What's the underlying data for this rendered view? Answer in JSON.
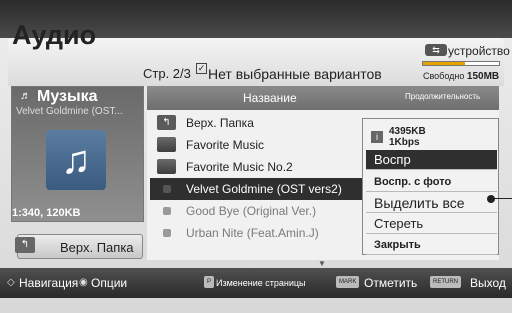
{
  "header": {
    "title": "Аудио",
    "page_indicator": "Стр. 2/3",
    "selection_status": "Нет выбранные вариантов",
    "device_label": "устройство",
    "device_icon": "usb-icon",
    "storage_used_fraction": 0.55,
    "free_label": "Свободно",
    "free_value": "150MB"
  },
  "folder_panel": {
    "heading": "Музыка",
    "subtitle": "Velvet Goldmine (OST...",
    "info": "1:340, 120KB",
    "art_icon": "music-note-icon",
    "up_button_label": "Верх. Папка"
  },
  "list": {
    "col_name": "Название",
    "col_duration": "Продолжительность",
    "rows": [
      {
        "label": "Верх. Папка",
        "type": "up"
      },
      {
        "label": "Favorite Music",
        "type": "folder"
      },
      {
        "label": "Favorite Music No.2",
        "type": "folder"
      },
      {
        "label": "Velvet Goldmine (OST vers2)",
        "type": "song",
        "selected": true
      },
      {
        "label": "Good Bye (Original Ver.)",
        "type": "song"
      },
      {
        "label": "Urban Nite (Feat.Amin.J)",
        "type": "song"
      }
    ]
  },
  "popup": {
    "size": "4395KB",
    "bitrate": "1Kbps",
    "items": [
      {
        "label": "Воспр",
        "active": true
      },
      {
        "label": "Воспр. с фото"
      },
      {
        "label": "Выделить все"
      },
      {
        "label": "Стереть"
      },
      {
        "label": "Закрыть"
      }
    ]
  },
  "help": {
    "nav": "Навигация",
    "options": "Опции",
    "page_key": "P",
    "page_change": "Изменение страницы",
    "mark_key": "MARK",
    "mark": "Отметить",
    "return_key": "RETURN",
    "exit": "Выход"
  },
  "colors": {
    "accent_bar": "#e7a400",
    "selected_row": "#2f2f2f"
  }
}
